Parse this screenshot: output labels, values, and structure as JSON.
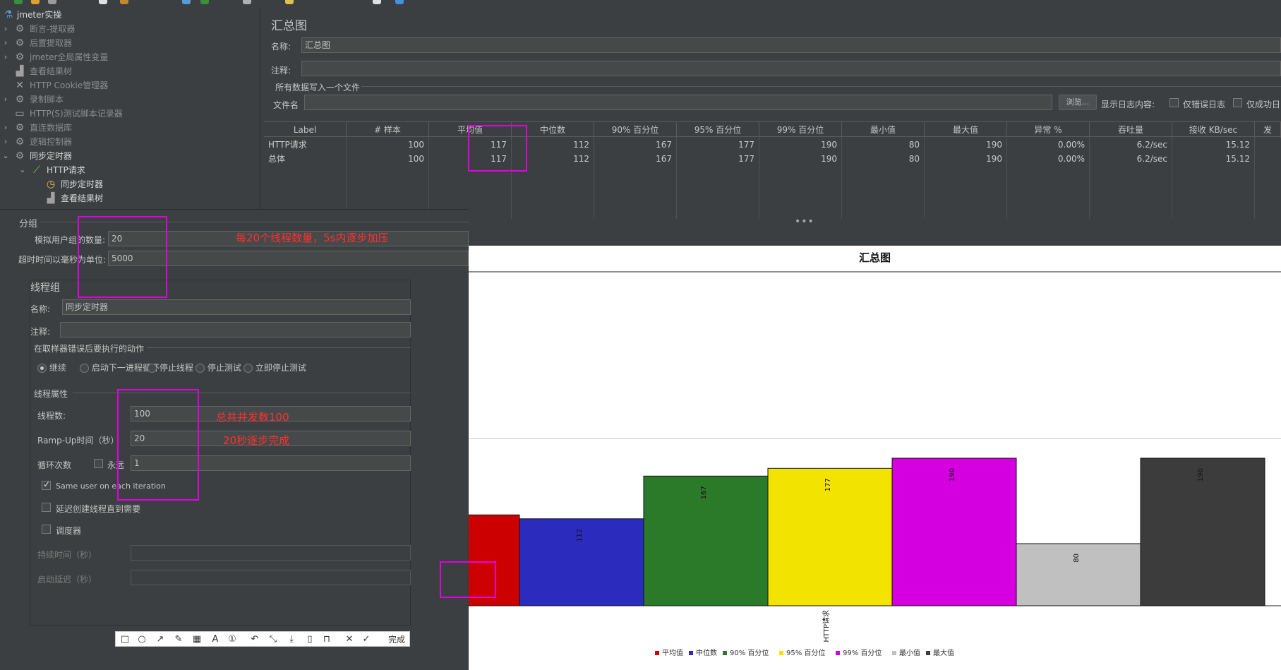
{
  "toolbar": {
    "icon_colors": [
      "#3a8f3a",
      "#e0a030",
      "#9b9b9b",
      "#e0e0e0",
      "#c0892f",
      "#5a9bd4",
      "#3a8f3a",
      "#b0b0b0",
      "#e0c050",
      "#e0e0e0",
      "#4a90e2"
    ]
  },
  "tree": {
    "root": "jmeter实操",
    "items": [
      {
        "label": "断言-提取器",
        "icon": "gear-icon",
        "expand": true
      },
      {
        "label": "后置提取器",
        "icon": "gear-icon",
        "expand": true
      },
      {
        "label": "jmeter全局属性变量",
        "icon": "gear-icon",
        "expand": true
      },
      {
        "label": "查看结果树",
        "icon": "chart-icon",
        "expand": false
      },
      {
        "label": "HTTP Cookie管理器",
        "icon": "wrench-icon",
        "expand": false
      },
      {
        "label": "录制脚本",
        "icon": "gear-icon",
        "expand": true
      },
      {
        "label": "HTTP(S)测试脚本记录器",
        "icon": "recorder-icon",
        "expand": false
      },
      {
        "label": "直连数据库",
        "icon": "gear-icon",
        "expand": true
      },
      {
        "label": "逻辑控制器",
        "icon": "gear-icon",
        "expand": true
      },
      {
        "label": "同步定时器",
        "icon": "gear-icon",
        "expand": "open"
      },
      {
        "label": "HTTP请求",
        "icon": "pipette-icon",
        "expand": "open"
      },
      {
        "label": "同步定时器",
        "icon": "clock-icon",
        "expand": false
      },
      {
        "label": "查看结果树",
        "icon": "chart-icon",
        "expand": false
      }
    ]
  },
  "summary": {
    "title": "汇总图",
    "name_label": "名称:",
    "name_value": "汇总图",
    "comment_label": "注释:",
    "file_section": "所有数据写入一个文件",
    "file_label": "文件名",
    "browse": "浏览...",
    "log_label": "显示日志内容:",
    "errors_only": "仅错误日志",
    "success_only": "仅成功日",
    "columns": [
      "Label",
      "# 样本",
      "平均值",
      "中位数",
      "90% 百分位",
      "95% 百分位",
      "99% 百分位",
      "最小值",
      "最大值",
      "异常 %",
      "吞吐量",
      "接收 KB/sec",
      "发"
    ],
    "rows": [
      [
        "HTTP请求",
        "100",
        "117",
        "112",
        "167",
        "177",
        "190",
        "80",
        "190",
        "0.00%",
        "6.2/sec",
        "15.12"
      ],
      [
        "总体",
        "100",
        "117",
        "112",
        "167",
        "177",
        "190",
        "80",
        "190",
        "0.00%",
        "6.2/sec",
        "15.12"
      ]
    ],
    "dots": "•••"
  },
  "chart_data": {
    "type": "bar",
    "title": "汇总图",
    "categories": [
      "HTTP请求"
    ],
    "series": [
      {
        "name": "平均值",
        "values": [
          117
        ],
        "color": "#cc0000"
      },
      {
        "name": "中位数",
        "values": [
          112
        ],
        "color": "#2b2bbd"
      },
      {
        "name": "90% 百分位",
        "values": [
          167
        ],
        "color": "#2a7a2a"
      },
      {
        "name": "95% 百分位",
        "values": [
          177
        ],
        "color": "#f2e400"
      },
      {
        "name": "99% 百分位",
        "values": [
          190
        ],
        "color": "#d400e0"
      },
      {
        "name": "最小值",
        "values": [
          80
        ],
        "color": "#c0c0c0"
      },
      {
        "name": "最大值",
        "values": [
          190
        ],
        "color": "#3c3c3c"
      }
    ],
    "ylim": [
      0,
      430
    ],
    "legend": "bottom",
    "grid": true
  },
  "config": {
    "group_section": "分组",
    "num_users_label": "模拟用户组的数量:",
    "num_users_value": "20",
    "timeout_label": "超时时间以毫秒为单位:",
    "timeout_value": "5000",
    "thread_group_title": "线程组",
    "tg_name_label": "名称:",
    "tg_name_value": "同步定时器",
    "tg_comment_label": "注释:",
    "error_action_label": "在取样器错误后要执行的动作",
    "actions": [
      "继续",
      "启动下一进程循环",
      "停止线程",
      "停止测试",
      "立即停止测试"
    ],
    "thread_props": "线程属性",
    "threads_label": "线程数:",
    "threads_value": "100",
    "rampup_label": "Ramp-Up时间（秒）",
    "rampup_value": "20",
    "loop_label": "循环次数",
    "forever_label": "永远",
    "loop_value": "1",
    "same_user": "Same user on each iteration",
    "delay_create": "延迟创建线程直到需要",
    "scheduler": "调度器",
    "duration_label": "持续时间（秒）",
    "startup_delay_label": "启动延迟（秒）"
  },
  "annotations": {
    "note1": "每20个线程数量，5s内逐步加压",
    "note2": "总共并发数100",
    "note3": "20秒逐步完成"
  },
  "shotbar": {
    "done": "完成"
  }
}
